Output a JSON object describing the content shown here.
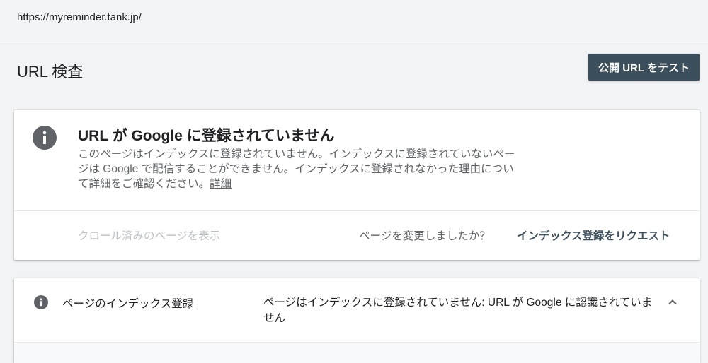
{
  "url_bar": {
    "url": "https://myreminder.tank.jp/"
  },
  "header": {
    "title": "URL 検査",
    "test_button_label": "公開 URL をテスト"
  },
  "status_card": {
    "icon": "info-icon",
    "heading": "URL が Google に登録されていません",
    "body": "このページはインデックスに登録されていません。インデックスに登録されていないページは Google で配信することができません。インデックスに登録されなかった理由について詳細をご確認ください。",
    "details_link": "詳細",
    "crawled_page_link": "クロール済みのページを表示",
    "changed_question": "ページを変更しましたか？",
    "request_indexing_label": "インデックス登録をリクエスト"
  },
  "indexing_section": {
    "icon": "info-icon",
    "label": "ページのインデックス登録",
    "status": "ページはインデックスに登録されていません: URL が Google に認識されていません",
    "expand_icon": "chevron-up-icon"
  },
  "colors": {
    "background": "#f1f3f4",
    "primary_button": "#3c4f5c",
    "icon_gray": "#5f6368"
  }
}
